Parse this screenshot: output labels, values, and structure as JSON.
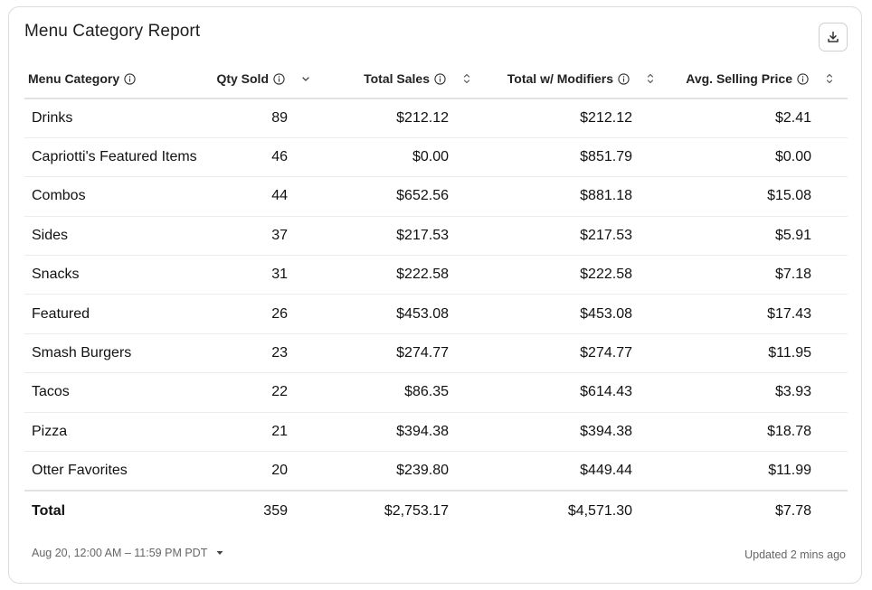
{
  "title": "Menu Category Report",
  "icons": {
    "download": "download-icon",
    "info": "info-icon",
    "sort": "sort-icon",
    "caret": "caret-down-icon"
  },
  "columns": [
    {
      "label": "Menu Category",
      "sort": "none"
    },
    {
      "label": "Qty Sold",
      "sort": "desc"
    },
    {
      "label": "Total Sales",
      "sort": "both"
    },
    {
      "label": "Total w/ Modifiers",
      "sort": "both"
    },
    {
      "label": "Avg. Selling Price",
      "sort": "both"
    }
  ],
  "rows": [
    [
      "Drinks",
      "89",
      "$212.12",
      "$212.12",
      "$2.41"
    ],
    [
      "Capriotti's Featured Items",
      "46",
      "$0.00",
      "$851.79",
      "$0.00"
    ],
    [
      "Combos",
      "44",
      "$652.56",
      "$881.18",
      "$15.08"
    ],
    [
      "Sides",
      "37",
      "$217.53",
      "$217.53",
      "$5.91"
    ],
    [
      "Snacks",
      "31",
      "$222.58",
      "$222.58",
      "$7.18"
    ],
    [
      "Featured",
      "26",
      "$453.08",
      "$453.08",
      "$17.43"
    ],
    [
      "Smash Burgers",
      "23",
      "$274.77",
      "$274.77",
      "$11.95"
    ],
    [
      "Tacos",
      "22",
      "$86.35",
      "$614.43",
      "$3.93"
    ],
    [
      "Pizza",
      "21",
      "$394.38",
      "$394.38",
      "$18.78"
    ],
    [
      "Otter Favorites",
      "20",
      "$239.80",
      "$449.44",
      "$11.99"
    ]
  ],
  "total": [
    "Total",
    "359",
    "$2,753.17",
    "$4,571.30",
    "$7.78"
  ],
  "footer": {
    "date_range": "Aug 20, 12:00 AM – 11:59 PM PDT",
    "updated": "Updated 2 mins ago"
  }
}
